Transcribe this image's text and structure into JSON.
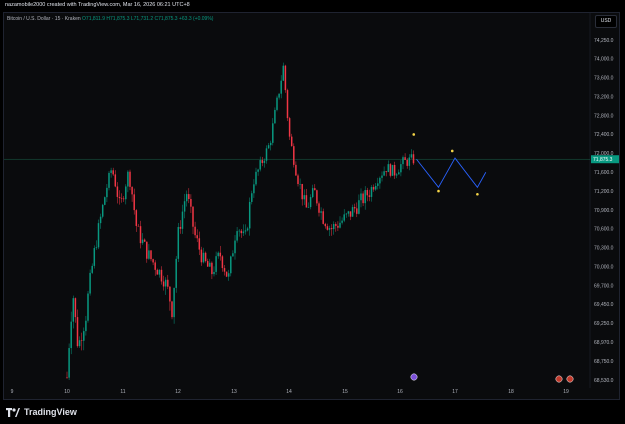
{
  "header": {
    "creator_text": "nazamobile2000 created with TradingView.com, Mar 16, 2026 06:21 UTC+8"
  },
  "legend": {
    "symbol": "Bitcoin / U.S. Dollar · 15 · Kraken",
    "ohlc": "O71,811.9  H71,875.3  L71,731.2  C71,875.3  +63.3 (+0.09%)"
  },
  "currency_label": "USD",
  "last_price_label": "71,875.3",
  "footer": {
    "brand": "TradingView"
  },
  "colors": {
    "up": "#089981",
    "down": "#f23645",
    "projection": "#2962ff",
    "marker": "#f5d547"
  },
  "chart_data": {
    "type": "candlestick",
    "symbol": "Bitcoin / U.S. Dollar",
    "interval": "15",
    "exchange": "Kraken",
    "y_ticks": [
      74250,
      74000,
      73600,
      73200,
      72800,
      72400,
      72000,
      71600,
      71200,
      70900,
      70600,
      70300,
      70000,
      69700,
      69450,
      69250,
      68970,
      68750,
      68530
    ],
    "y_tick_labels": [
      "74,250.0",
      "74,000.0",
      "73,600.0",
      "73,200.0",
      "72,800.0",
      "72,400.0",
      "72,000.0",
      "71,600.0",
      "71,200.0",
      "70,900.0",
      "70,600.0",
      "70,300.0",
      "70,000.0",
      "69,700.0",
      "69,450.0",
      "69,250.0",
      "68,970.0",
      "68,750.0",
      "68,530.0"
    ],
    "x_tick_labels": [
      "9",
      "10",
      "11",
      "12",
      "13",
      "14",
      "15",
      "16",
      "17",
      "18",
      "19"
    ],
    "last_price": 71875.3,
    "horizontal_level": 71875.3,
    "price_path": [
      {
        "day": 10.0,
        "price": 68560
      },
      {
        "day": 10.1,
        "price": 69650
      },
      {
        "day": 10.2,
        "price": 68900
      },
      {
        "day": 10.35,
        "price": 69400
      },
      {
        "day": 10.5,
        "price": 70300
      },
      {
        "day": 10.65,
        "price": 71000
      },
      {
        "day": 10.8,
        "price": 71700
      },
      {
        "day": 10.95,
        "price": 70900
      },
      {
        "day": 11.1,
        "price": 71600
      },
      {
        "day": 11.25,
        "price": 70600
      },
      {
        "day": 11.45,
        "price": 70200
      },
      {
        "day": 11.6,
        "price": 70000
      },
      {
        "day": 11.75,
        "price": 69800
      },
      {
        "day": 11.9,
        "price": 69400
      },
      {
        "day": 12.0,
        "price": 70500
      },
      {
        "day": 12.15,
        "price": 71200
      },
      {
        "day": 12.3,
        "price": 70500
      },
      {
        "day": 12.45,
        "price": 70100
      },
      {
        "day": 12.6,
        "price": 69900
      },
      {
        "day": 12.75,
        "price": 70200
      },
      {
        "day": 12.9,
        "price": 69800
      },
      {
        "day": 13.05,
        "price": 70700
      },
      {
        "day": 13.2,
        "price": 70400
      },
      {
        "day": 13.35,
        "price": 71400
      },
      {
        "day": 13.5,
        "price": 71800
      },
      {
        "day": 13.65,
        "price": 72200
      },
      {
        "day": 13.8,
        "price": 73200
      },
      {
        "day": 13.9,
        "price": 73850
      },
      {
        "day": 14.0,
        "price": 72400
      },
      {
        "day": 14.15,
        "price": 71500
      },
      {
        "day": 14.3,
        "price": 70900
      },
      {
        "day": 14.45,
        "price": 71200
      },
      {
        "day": 14.6,
        "price": 70800
      },
      {
        "day": 14.75,
        "price": 70600
      },
      {
        "day": 14.9,
        "price": 70700
      },
      {
        "day": 15.05,
        "price": 70800
      },
      {
        "day": 15.25,
        "price": 71000
      },
      {
        "day": 15.45,
        "price": 71200
      },
      {
        "day": 15.6,
        "price": 71500
      },
      {
        "day": 15.75,
        "price": 71700
      },
      {
        "day": 15.9,
        "price": 71600
      },
      {
        "day": 16.05,
        "price": 71800
      },
      {
        "day": 16.25,
        "price": 71875
      }
    ],
    "projection": [
      {
        "day": 16.3,
        "price": 71875
      },
      {
        "day": 16.7,
        "price": 71280
      },
      {
        "day": 17.0,
        "price": 71900
      },
      {
        "day": 17.4,
        "price": 71280
      },
      {
        "day": 17.55,
        "price": 71600
      }
    ],
    "wave_markers": [
      {
        "day": 16.25,
        "price": 72400
      },
      {
        "day": 16.7,
        "price": 71200
      },
      {
        "day": 16.95,
        "price": 72050
      },
      {
        "day": 17.4,
        "price": 71150
      }
    ]
  }
}
